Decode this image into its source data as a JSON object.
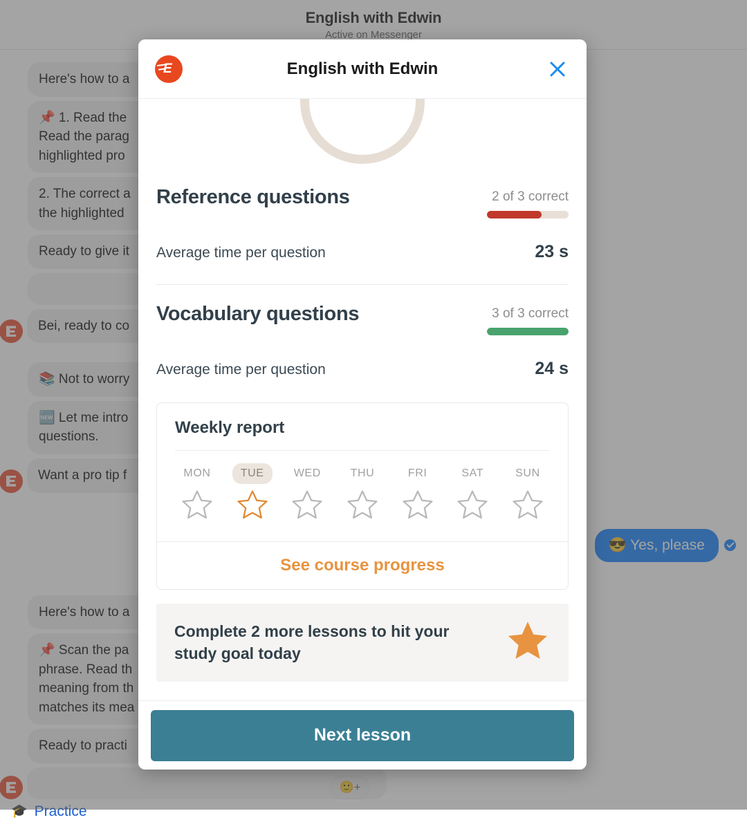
{
  "background": {
    "header": {
      "title": "English with Edwin",
      "status": "Active on Messenger"
    },
    "messages": [
      {
        "text": "Here's how to a",
        "side": "in",
        "avatar": false
      },
      {
        "text": "📌 1. Read the\nRead the parag\nhighlighted pro",
        "side": "in",
        "avatar": false
      },
      {
        "text": "2. The correct a\nthe highlighted",
        "side": "in",
        "avatar": false
      },
      {
        "text": "Ready to give it",
        "side": "in",
        "avatar": false
      },
      {
        "text": "",
        "side": "in",
        "avatar": false
      },
      {
        "text": "Bei, ready to co",
        "side": "in",
        "avatar": true
      },
      {
        "text": "📚 Not to worry",
        "side": "in",
        "avatar": false
      },
      {
        "text": "🆕 Let me intro\nquestions.",
        "side": "in",
        "avatar": false
      },
      {
        "text": "Want a pro tip f",
        "side": "in",
        "avatar": true
      },
      {
        "text": "😎 Yes, please",
        "side": "out",
        "avatar": false
      },
      {
        "text": "Here's how to a",
        "side": "in",
        "avatar": false
      },
      {
        "text": "📌 Scan the pa\nphrase. Read th\nmeaning from th\nmatches its mea",
        "side": "in",
        "avatar": false
      },
      {
        "text": "Ready to practi",
        "side": "in",
        "avatar": false
      },
      {
        "text": "",
        "side": "in",
        "avatar": true
      }
    ],
    "outgoing_bubble": "😎 Yes, please",
    "practice_link": "Practice",
    "practice_icon": "graduation-cap-icon",
    "reaction_button": "🙂+"
  },
  "modal": {
    "logo_alt": "edwin-logo-icon",
    "title": "English with Edwin",
    "close_label": "×",
    "sections": [
      {
        "id": "reference",
        "title": "Reference questions",
        "score_label": "2 of 3 correct",
        "correct": 2,
        "total": 3,
        "progress_percent": 67,
        "bar_color": "#c0392b",
        "track_color": "#e8e0d7",
        "stat_label": "Average time per question",
        "stat_value": "23 s"
      },
      {
        "id": "vocabulary",
        "title": "Vocabulary questions",
        "score_label": "3 of 3 correct",
        "correct": 3,
        "total": 3,
        "progress_percent": 100,
        "bar_color": "#49a26e",
        "track_color": "#e8e0d7",
        "stat_label": "Average time per question",
        "stat_value": "24 s"
      }
    ],
    "weekly_report": {
      "title": "Weekly report",
      "today": "TUE",
      "days": [
        {
          "label": "MON",
          "earned": false,
          "today": false
        },
        {
          "label": "TUE",
          "earned": false,
          "today": true
        },
        {
          "label": "WED",
          "earned": false,
          "today": false
        },
        {
          "label": "THU",
          "earned": false,
          "today": false
        },
        {
          "label": "FRI",
          "earned": false,
          "today": false
        },
        {
          "label": "SAT",
          "earned": false,
          "today": false
        },
        {
          "label": "SUN",
          "earned": false,
          "today": false
        }
      ],
      "link_label": "See course progress",
      "link_color": "#e8933f"
    },
    "goal_banner": {
      "text": "Complete 2 more lessons to hit your study goal today",
      "icon": "star-filled-icon",
      "icon_color": "#e8933f"
    },
    "footer": {
      "primary_button": "Next lesson",
      "primary_color": "#3b7f94"
    }
  }
}
